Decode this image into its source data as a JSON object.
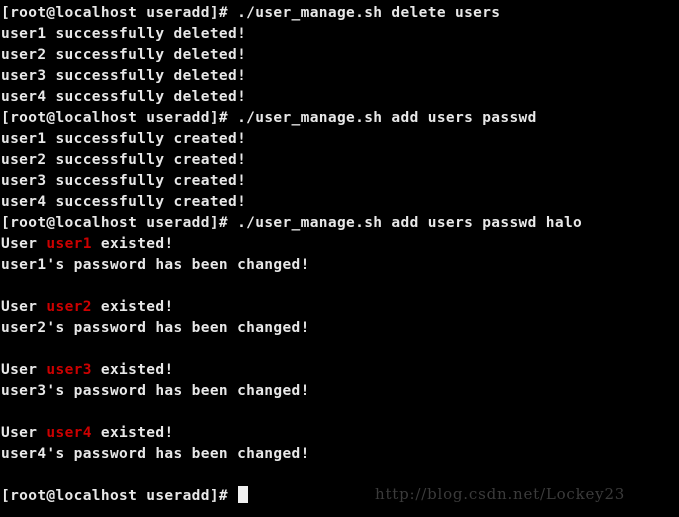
{
  "terminal": {
    "background_color": "#000000",
    "foreground_color": "#e8e8e8",
    "highlight_color": "#cc0000",
    "prompt": "[root@localhost useradd]# ",
    "lines": [
      {
        "type": "command",
        "prompt": "[root@localhost useradd]# ",
        "command": "./user_manage.sh delete users"
      },
      {
        "type": "output",
        "text": "user1 successfully deleted!"
      },
      {
        "type": "output",
        "text": "user2 successfully deleted!"
      },
      {
        "type": "output",
        "text": "user3 successfully deleted!"
      },
      {
        "type": "output",
        "text": "user4 successfully deleted!"
      },
      {
        "type": "command",
        "prompt": "[root@localhost useradd]# ",
        "command": "./user_manage.sh add users passwd"
      },
      {
        "type": "output",
        "text": "user1 successfully created!"
      },
      {
        "type": "output",
        "text": "user2 successfully created!"
      },
      {
        "type": "output",
        "text": "user3 successfully created!"
      },
      {
        "type": "output",
        "text": "user4 successfully created!"
      },
      {
        "type": "command",
        "prompt": "[root@localhost useradd]# ",
        "command": "./user_manage.sh add users passwd halo"
      },
      {
        "type": "output_colored",
        "before": "User ",
        "highlight": "user1",
        "after": " existed!"
      },
      {
        "type": "output",
        "text": "user1's password has been changed!"
      },
      {
        "type": "blank",
        "text": ""
      },
      {
        "type": "output_colored",
        "before": "User ",
        "highlight": "user2",
        "after": " existed!"
      },
      {
        "type": "output",
        "text": "user2's password has been changed!"
      },
      {
        "type": "blank",
        "text": ""
      },
      {
        "type": "output_colored",
        "before": "User ",
        "highlight": "user3",
        "after": " existed!"
      },
      {
        "type": "output",
        "text": "user3's password has been changed!"
      },
      {
        "type": "blank",
        "text": ""
      },
      {
        "type": "output_colored",
        "before": "User ",
        "highlight": "user4",
        "after": " existed!"
      },
      {
        "type": "output",
        "text": "user4's password has been changed!"
      },
      {
        "type": "blank",
        "text": ""
      },
      {
        "type": "prompt_cursor",
        "prompt": "[root@localhost useradd]# "
      }
    ]
  },
  "watermark": {
    "text": "http://blog.csdn.net/Lockey23"
  }
}
